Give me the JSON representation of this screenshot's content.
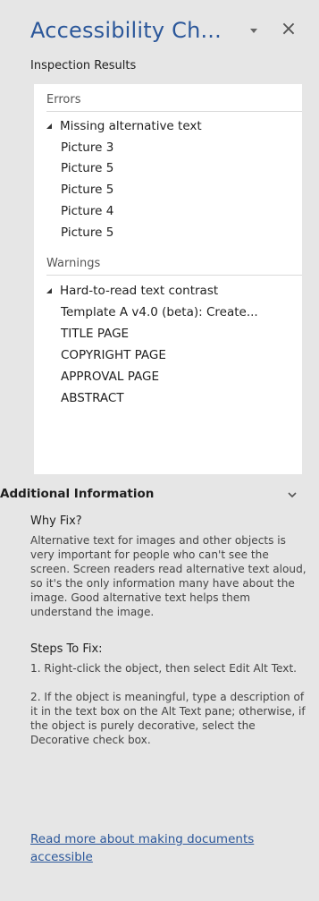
{
  "pane": {
    "title": "Accessibility Ch...",
    "menu_icon": "chevron-down-icon",
    "close_icon": "close-icon",
    "close_glyph": "×"
  },
  "inspection": {
    "label": "Inspection Results",
    "errors": {
      "header": "Errors",
      "issues": [
        {
          "title": "Missing alternative text",
          "items": [
            "Picture 3",
            "Picture 5",
            "Picture 5",
            "Picture 4",
            "Picture 5"
          ]
        }
      ]
    },
    "warnings": {
      "header": "Warnings",
      "issues": [
        {
          "title": "Hard-to-read text contrast",
          "items": [
            "Template A v4.0 (beta): Create...",
            "TITLE PAGE",
            "COPYRIGHT PAGE",
            "APPROVAL PAGE",
            "ABSTRACT"
          ]
        }
      ]
    }
  },
  "info": {
    "title": "Additional Information",
    "why_fix": {
      "heading": "Why Fix?",
      "text": "Alternative text for images and other objects is very important for people who can't see the screen. Screen readers read alternative text aloud, so it's the only information many have about the image. Good alternative text helps them understand the image."
    },
    "steps": {
      "heading": "Steps To Fix:",
      "step1": "1. Right-click the object, then select Edit Alt Text.",
      "step2": "2. If the object is meaningful, type a description of it in the text box on the Alt Text pane; otherwise, if the object is purely decorative, select the Decorative check box."
    },
    "link": "Read more about making documents accessible"
  },
  "colors": {
    "accent": "#2b579a",
    "pane_bg": "#e6e6e6",
    "results_bg": "#ffffff"
  }
}
